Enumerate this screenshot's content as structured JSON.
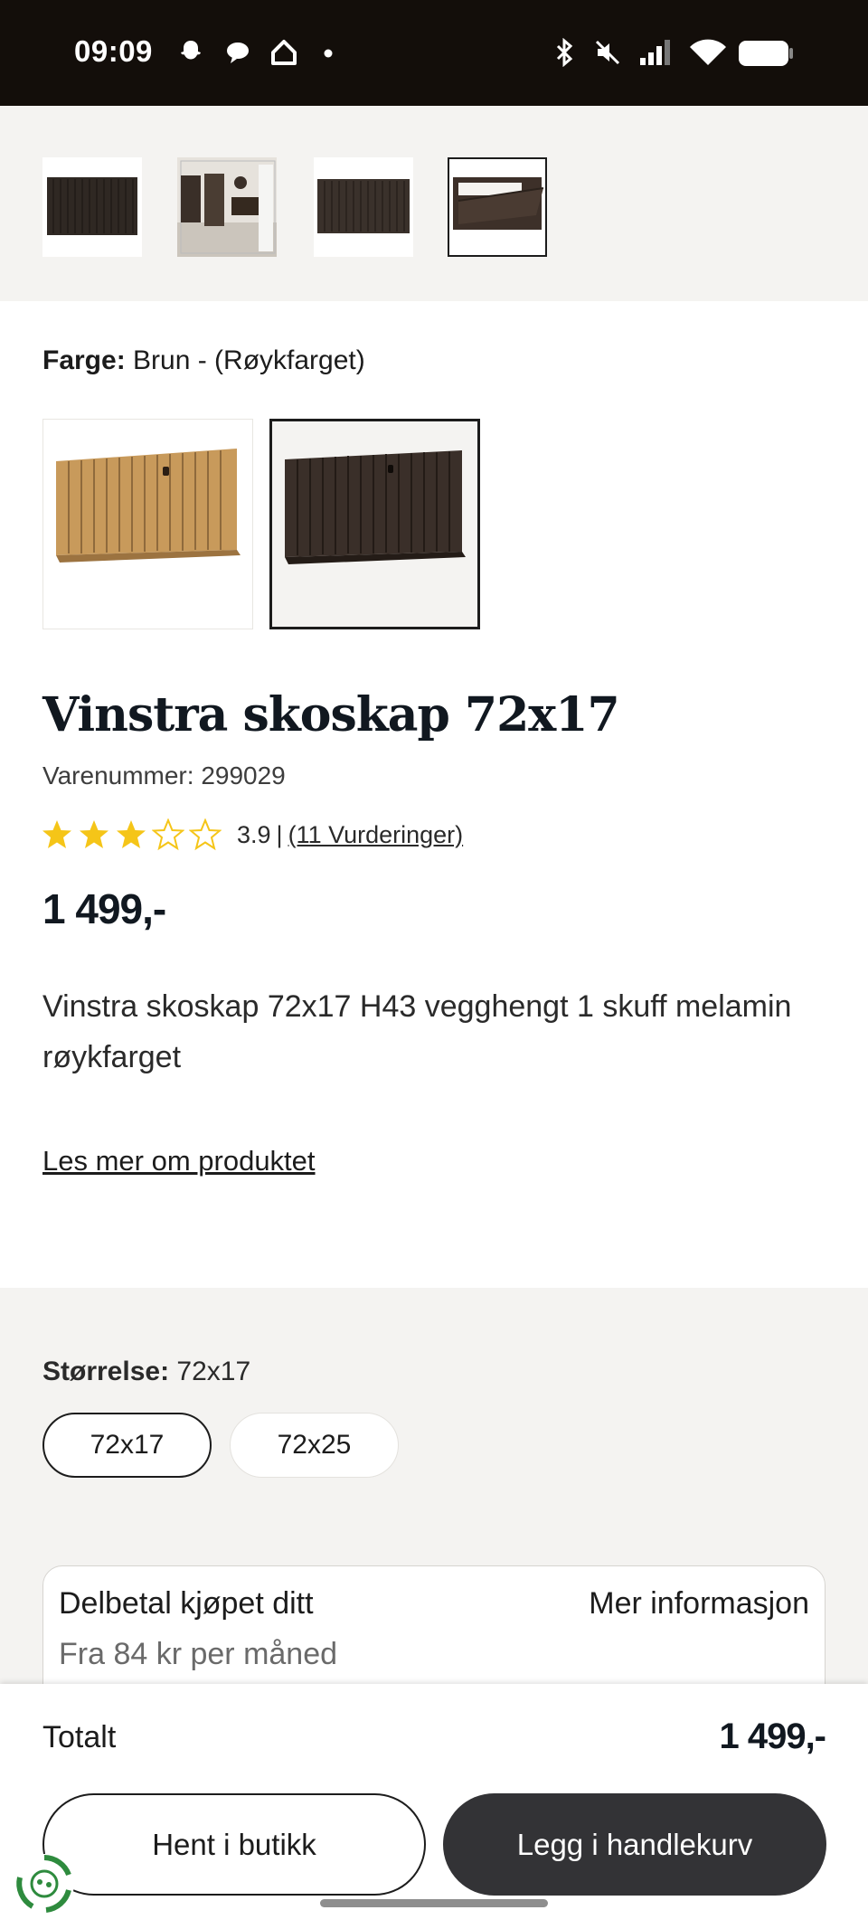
{
  "status_bar": {
    "time": "09:09",
    "icons": [
      "snapchat-icon",
      "chat-icon",
      "home-icon",
      "dot-icon",
      "bluetooth-icon",
      "mute-icon",
      "signal-icon",
      "wifi-icon",
      "battery-icon"
    ]
  },
  "gallery": {
    "thumbnails": [
      "thumb-cabinet-front",
      "thumb-room-scene",
      "thumb-cabinet-flat",
      "thumb-cabinet-open"
    ],
    "selected_index": 3
  },
  "color": {
    "label": "Farge:",
    "value": "Brun - (Røykfarget)",
    "options": [
      "oak",
      "brown"
    ],
    "selected_index": 1
  },
  "product": {
    "title": "Vinstra skoskap 72x17",
    "sku": "Varenummer: 299029",
    "rating": 3.9,
    "rating_value": "3.9",
    "rating_sep": "|",
    "reviews_link": "(11 Vurderinger)",
    "price": "1 499,-",
    "description": "Vinstra skoskap 72x17 H43 vegghengt 1 skuff melamin røykfarget",
    "read_more": "Les mer om produktet"
  },
  "size": {
    "label": "Størrelse:",
    "value": "72x17",
    "options": [
      "72x17",
      "72x25"
    ],
    "selected_index": 0
  },
  "installment": {
    "title": "Delbetal kjøpet ditt",
    "more_link": "Mer informasjon",
    "subtitle": "Fra 84 kr per måned"
  },
  "footer": {
    "total_label": "Totalt",
    "total_price": "1 499,-",
    "store_button": "Hent i butikk",
    "cart_button": "Legg i handlekurv"
  },
  "colors": {
    "status_bar": "#130e0a",
    "section_bg": "#f4f3f1",
    "cart_button": "#333336",
    "star": "#f5c518",
    "text": "#1c1c1c"
  }
}
